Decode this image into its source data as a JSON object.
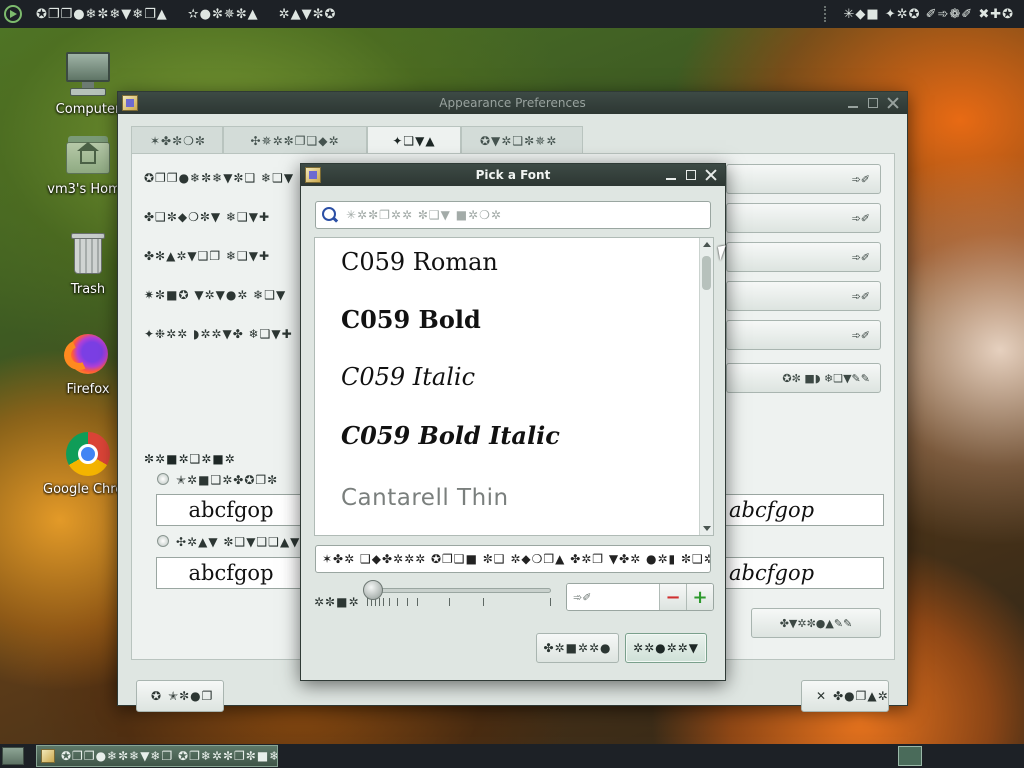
{
  "top_panel": {
    "menu_label": "✪❐❐●❄✼❄▼❄❐▲",
    "places_label": "✫●✼✵✼▲",
    "system_label": "✲▲▼✼✪",
    "tray_label": "✳◆■ ✦✲✪ ✐➾❁✐ ✖✚✪"
  },
  "desktop_icons": [
    {
      "label": "Computer",
      "icon": "computer-icon"
    },
    {
      "label": "vm3's Home",
      "icon": "home-folder-icon"
    },
    {
      "label": "Trash",
      "icon": "trash-icon"
    },
    {
      "label": "Firefox",
      "icon": "firefox-icon"
    },
    {
      "label": "Google Chrome",
      "icon": "chrome-icon"
    }
  ],
  "appearance": {
    "title": "Appearance Preferences",
    "tabs": [
      "✶✤✼❍✼",
      "✣✵✲✼❐❑◆✲",
      "✦❑▼▲",
      "✪▼✲❑✼✵✲"
    ],
    "active_tab": 2,
    "font_rows": [
      {
        "label": "✪❐❐●❄✼❄▼✼❑ ❄❑▼",
        "button": "➾✐"
      },
      {
        "label": "✤❑✼◆❍✼▼ ❄❑▼✚",
        "button": "➾✐"
      },
      {
        "label": "✤✻▲✲▼❑❐ ❄❑▼✚",
        "button": "➾✐"
      },
      {
        "label": "✷✼■✪ ▼✲▼●✲ ❄❑▼",
        "button": "➾✐"
      },
      {
        "label": "✦❉✲✲ ◗✲✲▼✤ ❄❑▼✚",
        "button": "➾✐"
      }
    ],
    "details_button": "✪✼ ■◗ ❄❑▼✎✎",
    "rendering_title": "✼✲■✲❑✲■✲",
    "option1_label": "✭✲■❑✲✤✪❐✼",
    "option2_label": "✣✲▲▼ ✼❑▼❑❑▲▼",
    "sample_text": "abcfgop",
    "details_bottom_button": "✤▼✲✼●▲✎✎",
    "help_button": "✭✼●❐",
    "close_button": "✤●❐▲✲"
  },
  "pickfont": {
    "title": "Pick a Font",
    "search_placeholder": "✳✲✼❐✲✲ ✼❑▼ ■✲❍✲",
    "fonts": [
      "C059 Roman",
      "C059 Bold",
      "C059 Italic",
      "C059 Bold Italic",
      "Cantarell Thin"
    ],
    "preview_text": "✶✤✲ ❑◆✤✲✲✲ ✪❐❑■ ✼❑ ✲◆❍❐▲ ✤✲❐ ▼✤✲ ●✲▮ ✼❑✲✎",
    "size_label": "✲✼■✲",
    "size_value": "➾✐",
    "cancel_button": "✤✲■✲✲●",
    "select_button": "✲✲●✲✲▼"
  },
  "bottom_panel": {
    "task_label": "✪❐❐●❄✼❄▼❄❐ ✪❐❄✲✼❐✼■❄▲"
  }
}
